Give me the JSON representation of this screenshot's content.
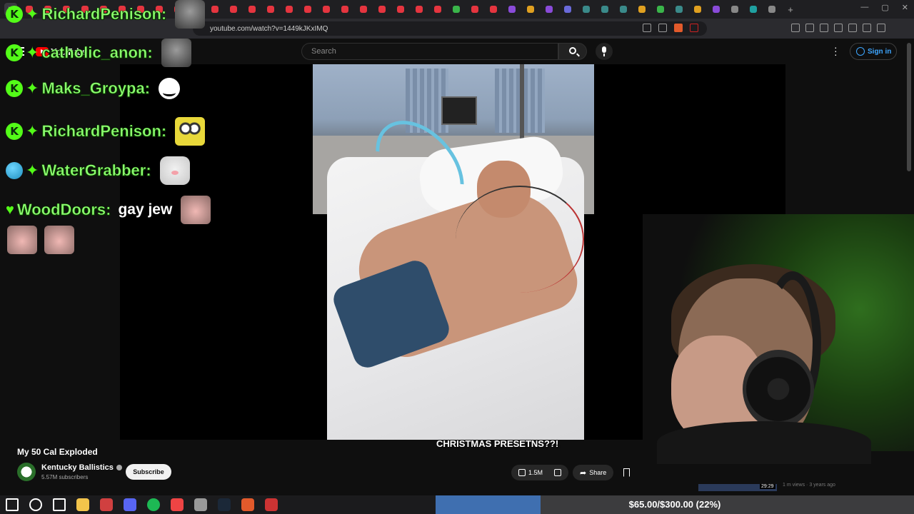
{
  "browser": {
    "url": "youtube.com/watch?v=1449kJKxIMQ",
    "tab_colors": [
      "#e5353f",
      "#e5353f",
      "#e5353f",
      "#e5353f",
      "#e5353f",
      "#e5353f",
      "#e5353f",
      "#e5353f",
      "#e5353f",
      "#e5353f",
      "#e5353f",
      "#e5353f",
      "#e5353f",
      "#e5353f",
      "#e5353f",
      "#e5353f",
      "#e5353f",
      "#e5353f",
      "#e5353f",
      "#e5353f",
      "#e5353f",
      "#e5353f",
      "#e5353f",
      "#e5353f",
      "#3ab54a",
      "#e5353f",
      "#e5353f",
      "#8a4bd9",
      "#e0a020",
      "#8a4bd9",
      "#6a6ad9",
      "#3a8a8a",
      "#3a8a8a",
      "#3a8a8a",
      "#e0a020",
      "#3ab54a",
      "#3a8a8a",
      "#e0a020",
      "#8a4bd9",
      "#888888",
      "#1fa0a0",
      "#888888"
    ]
  },
  "youtube": {
    "logo_text": "YouTube",
    "search_placeholder": "Search",
    "sign_in": "Sign in",
    "video_title": "My 50 Cal Exploded",
    "channel_name": "Kentucky Ballistics",
    "subscribers": "5.57M subscribers",
    "subscribe_label": "Subscribe",
    "likes": "1.5M",
    "share_label": "Share",
    "sidebar_duration": "29:29",
    "sidebar_meta": "1 m views · 3 years ago"
  },
  "chat": [
    {
      "user": "RichardPenison",
      "badge": "kick",
      "emote": "gray",
      "text": ""
    },
    {
      "user": "catholic_anon",
      "badge": "kick",
      "emote": "gray",
      "text": ""
    },
    {
      "user": "Maks_Groypa",
      "badge": "kick",
      "emote": "troll",
      "text": ""
    },
    {
      "user": "RichardPenison",
      "badge": "kick",
      "emote": "sponge",
      "text": ""
    },
    {
      "user": "WaterGrabber",
      "badge": "globe",
      "emote": "cat",
      "text": ""
    },
    {
      "user": "WoodDoors",
      "badge": "heart",
      "emote": "catpink",
      "text": "gay jew"
    }
  ],
  "stream_caption": "CHRISTMAS PRESETNS??!",
  "goal": {
    "text": "$65.00/$300.00 (22%)",
    "fraction": 0.22
  },
  "taskbar_icons": [
    "windows-icon",
    "search-icon",
    "taskview-icon",
    "folder-icon",
    "obs-icon",
    "discord-icon",
    "spotify-icon",
    "chrome-icon",
    "app-icon",
    "steam-icon",
    "brave-icon",
    "app2-icon"
  ]
}
